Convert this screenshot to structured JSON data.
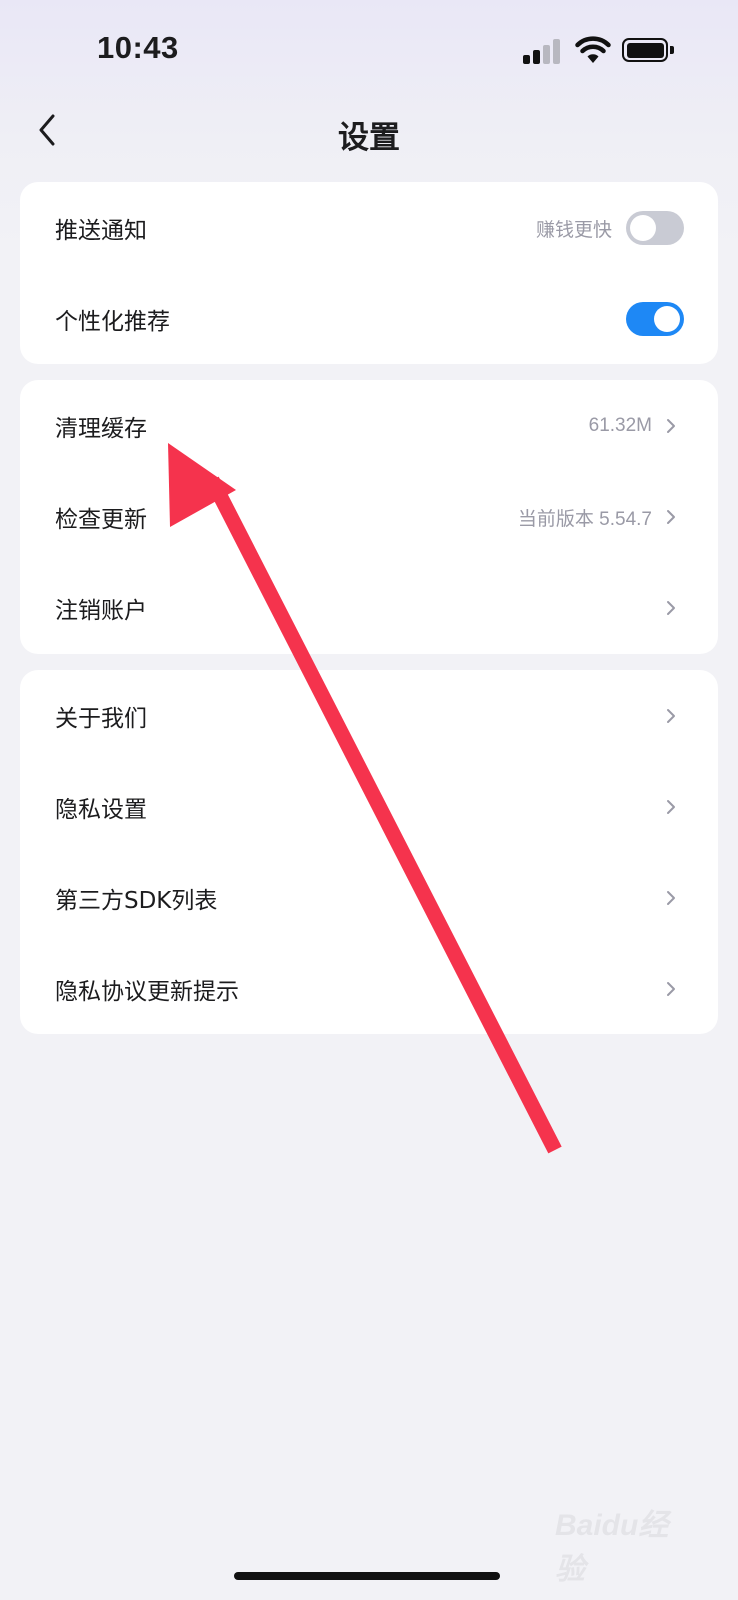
{
  "status": {
    "time": "10:43"
  },
  "nav": {
    "title": "设置"
  },
  "sections": [
    {
      "items": [
        {
          "label": "推送通知",
          "hint": "赚钱更快",
          "toggle": "off"
        },
        {
          "label": "个性化推荐",
          "toggle": "on"
        }
      ]
    },
    {
      "items": [
        {
          "label": "清理缓存",
          "value": "61.32M"
        },
        {
          "label": "检查更新",
          "value": "当前版本 5.54.7"
        },
        {
          "label": "注销账户"
        }
      ]
    },
    {
      "items": [
        {
          "label": "关于我们"
        },
        {
          "label": "隐私设置"
        },
        {
          "label": "第三方SDK列表"
        },
        {
          "label": "隐私协议更新提示"
        }
      ]
    }
  ],
  "colors": {
    "toggle_on": "#1e88f5",
    "toggle_off": "#c9cbd4",
    "annotation_arrow": "#f5334d"
  },
  "watermark": {
    "text": "Baidu经验"
  }
}
